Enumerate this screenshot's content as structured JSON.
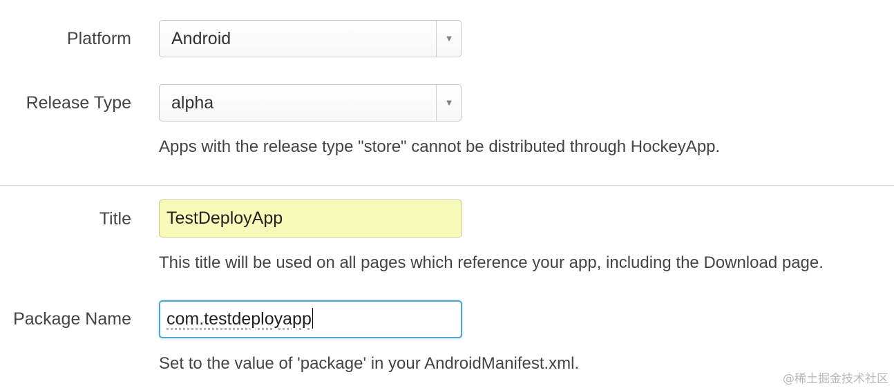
{
  "form": {
    "platform": {
      "label": "Platform",
      "selected": "Android"
    },
    "release_type": {
      "label": "Release Type",
      "selected": "alpha",
      "help": "Apps with the release type \"store\" cannot be distributed through HockeyApp."
    },
    "title": {
      "label": "Title",
      "value": "TestDeployApp",
      "help": "This title will be used on all pages which reference your app, including the Download page."
    },
    "package_name": {
      "label": "Package Name",
      "value": "com.testdeployapp",
      "help": "Set to the value of 'package' in your AndroidManifest.xml."
    }
  },
  "watermark": "@稀土掘金技术社区",
  "icons": {
    "dropdown": "triangle-down-icon"
  },
  "colors": {
    "title_field_bg": "#f8fab9",
    "focus_border": "#4fa6d3"
  }
}
